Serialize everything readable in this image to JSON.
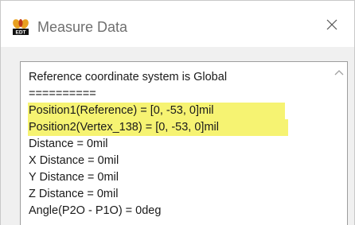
{
  "window": {
    "title": "Measure Data",
    "icon_name": "edt-app-icon",
    "close_icon": "close-icon"
  },
  "content": {
    "lines": [
      {
        "text": "Reference coordinate system is Global",
        "highlight": false
      },
      {
        "text": "==========",
        "highlight": false
      },
      {
        "text": "Position1(Reference) = [0, -53, 0]mil",
        "highlight": true
      },
      {
        "text": "Position2(Vertex_138) = [0, -53, 0]mil",
        "highlight": true
      },
      {
        "text": "Distance = 0mil",
        "highlight": false
      },
      {
        "text": "X Distance = 0mil",
        "highlight": false
      },
      {
        "text": "Y Distance = 0mil",
        "highlight": false
      },
      {
        "text": "Z Distance = 0mil",
        "highlight": false
      },
      {
        "text": "Angle(P2O - P1O) = 0deg",
        "highlight": false
      }
    ],
    "highlight_color": "#f6f372"
  },
  "scrollbar": {
    "up_icon": "chevron-up-icon"
  }
}
